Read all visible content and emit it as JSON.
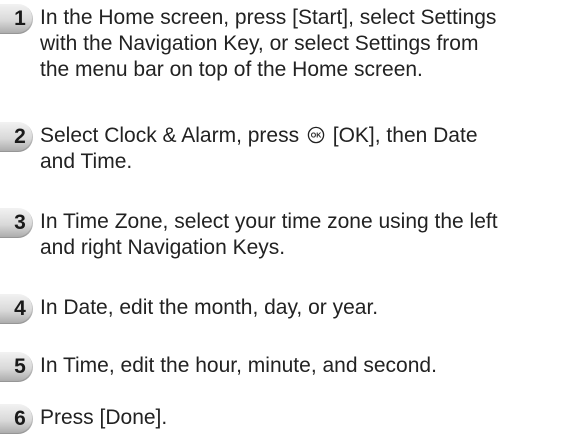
{
  "steps": [
    {
      "number": "1",
      "lines": [
        "In the Home screen, press [Start], select Settings",
        "with the Navigation Key, or select Settings from",
        "the menu bar on top of the Home screen."
      ]
    },
    {
      "number": "2",
      "line1_before_icon": "Select Clock & Alarm, press ",
      "icon_label": "OK",
      "line1_after_icon": " [OK], then Date",
      "line2": "and Time."
    },
    {
      "number": "3",
      "lines": [
        "In Time Zone, select your time zone using the left",
        "and right Navigation Keys."
      ]
    },
    {
      "number": "4",
      "lines": [
        "In Date, edit the month, day, or year."
      ]
    },
    {
      "number": "5",
      "lines": [
        "In Time, edit the hour, minute, and second."
      ]
    },
    {
      "number": "6",
      "lines": [
        "Press [Done]."
      ]
    }
  ],
  "colors": {
    "text": "#222222",
    "badge_light": "#f2f2f2",
    "badge_dark": "#a9a9a9"
  }
}
